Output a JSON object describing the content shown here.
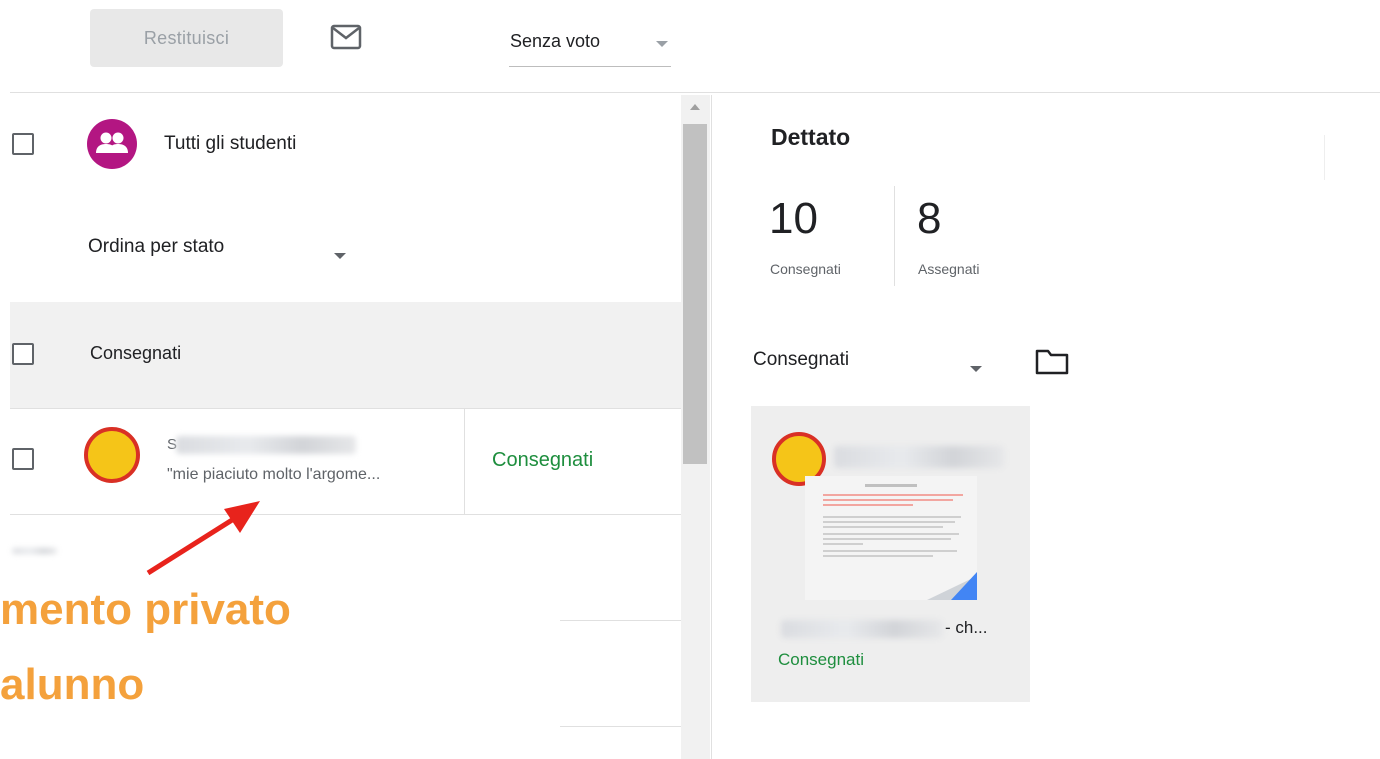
{
  "toolbar": {
    "return_label": "Restituisci",
    "grade_select_value": "Senza voto",
    "mail_icon": "mail-icon"
  },
  "students_list": {
    "all_students_label": "Tutti gli studenti",
    "sort_label": "Ordina per stato",
    "group_label": "Consegnati",
    "rows": [
      {
        "name_initial": "S",
        "comment": "\"mie piaciuto molto l'argome...",
        "status": "Consegnati"
      }
    ]
  },
  "annotation": {
    "line1": "mento privato",
    "line2": "alunno",
    "color": "#f4a13c",
    "arrow_color": "#e8231c"
  },
  "assignment": {
    "title": "Dettato",
    "stats": [
      {
        "value": "10",
        "label": "Consegnati"
      },
      {
        "value": "8",
        "label": "Assegnati"
      }
    ],
    "filter_label": "Consegnati",
    "folder_icon": "folder-icon",
    "card": {
      "file_suffix": "- ch...",
      "status": "Consegnati"
    }
  },
  "colors": {
    "status_green": "#1e8e3e",
    "group_avatar": "#b31682",
    "student_avatar_fill": "#f5c518",
    "student_avatar_ring": "#d93025"
  }
}
